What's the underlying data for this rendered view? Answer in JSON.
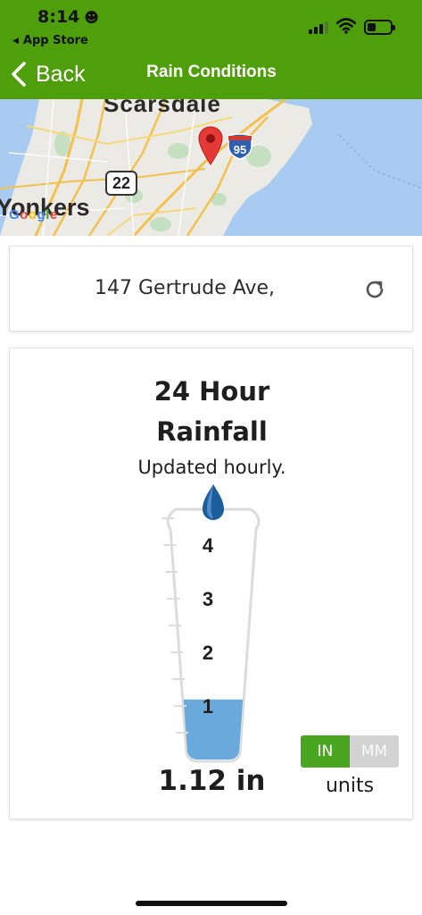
{
  "status_bar": {
    "time": "8:14",
    "back_app": "App Store"
  },
  "nav": {
    "back_label": "Back",
    "title": "Rain Conditions",
    "bar_color": "#4f9f0c"
  },
  "map": {
    "labels": [
      "Scarsdale",
      "Yonkers"
    ],
    "shields": [
      "95",
      "22"
    ],
    "google": [
      "G",
      "o",
      "o",
      "g",
      "l",
      "e"
    ]
  },
  "address": {
    "text": "147 Gertrude Ave,"
  },
  "rainfall": {
    "title_line1": "24 Hour",
    "title_line2": "Rainfall",
    "subtitle": "Updated hourly.",
    "gauge_ticks": [
      "4",
      "3",
      "2",
      "1"
    ],
    "gauge_max": 4.5,
    "value": 1.12,
    "amount_text": "1.12 in",
    "fill_color": "#6aa9dc"
  },
  "units": {
    "options": [
      "IN",
      "MM"
    ],
    "selected": "IN",
    "label": "units"
  }
}
